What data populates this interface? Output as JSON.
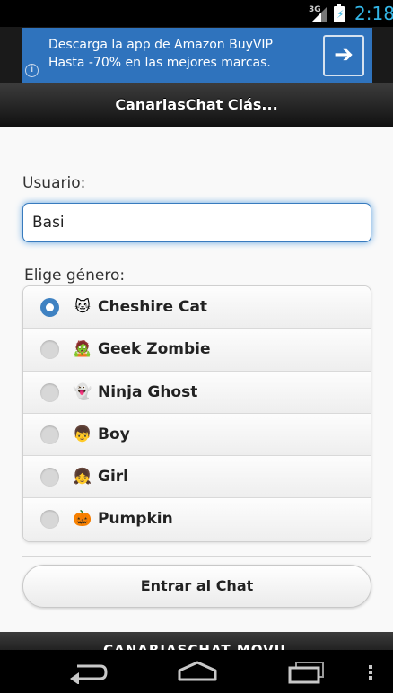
{
  "status_bar": {
    "network": "3G",
    "time": "2:18",
    "icons": [
      "signal-icon",
      "battery-charging-icon"
    ]
  },
  "ad": {
    "line1": "Descarga la app de Amazon BuyVIP",
    "line2": "Hasta -70% en las mejores marcas.",
    "info_glyph": "i",
    "arrow_glyph": "➔",
    "background": "#2f73bd"
  },
  "header": {
    "title": "CanariasChat Clás..."
  },
  "form": {
    "user_label": "Usuario:",
    "user_value": "Basi",
    "gender_label": "Elige género:",
    "options": [
      {
        "label": "Cheshire Cat",
        "emoji": "🐱",
        "checked": true
      },
      {
        "label": "Geek Zombie",
        "emoji": "🧟",
        "checked": false
      },
      {
        "label": "Ninja Ghost",
        "emoji": "👻",
        "checked": false
      },
      {
        "label": "Boy",
        "emoji": "👦",
        "checked": false
      },
      {
        "label": "Girl",
        "emoji": "👧",
        "checked": false
      },
      {
        "label": "Pumpkin",
        "emoji": "🎃",
        "checked": false
      }
    ],
    "submit_label": "Entrar al Chat",
    "accent": "#3f82c2"
  },
  "footer": {
    "title": "CANARIASCHAT MOVIL"
  },
  "navbar": {
    "icons": [
      "back-icon",
      "home-icon",
      "recent-apps-icon",
      "menu-icon"
    ]
  }
}
